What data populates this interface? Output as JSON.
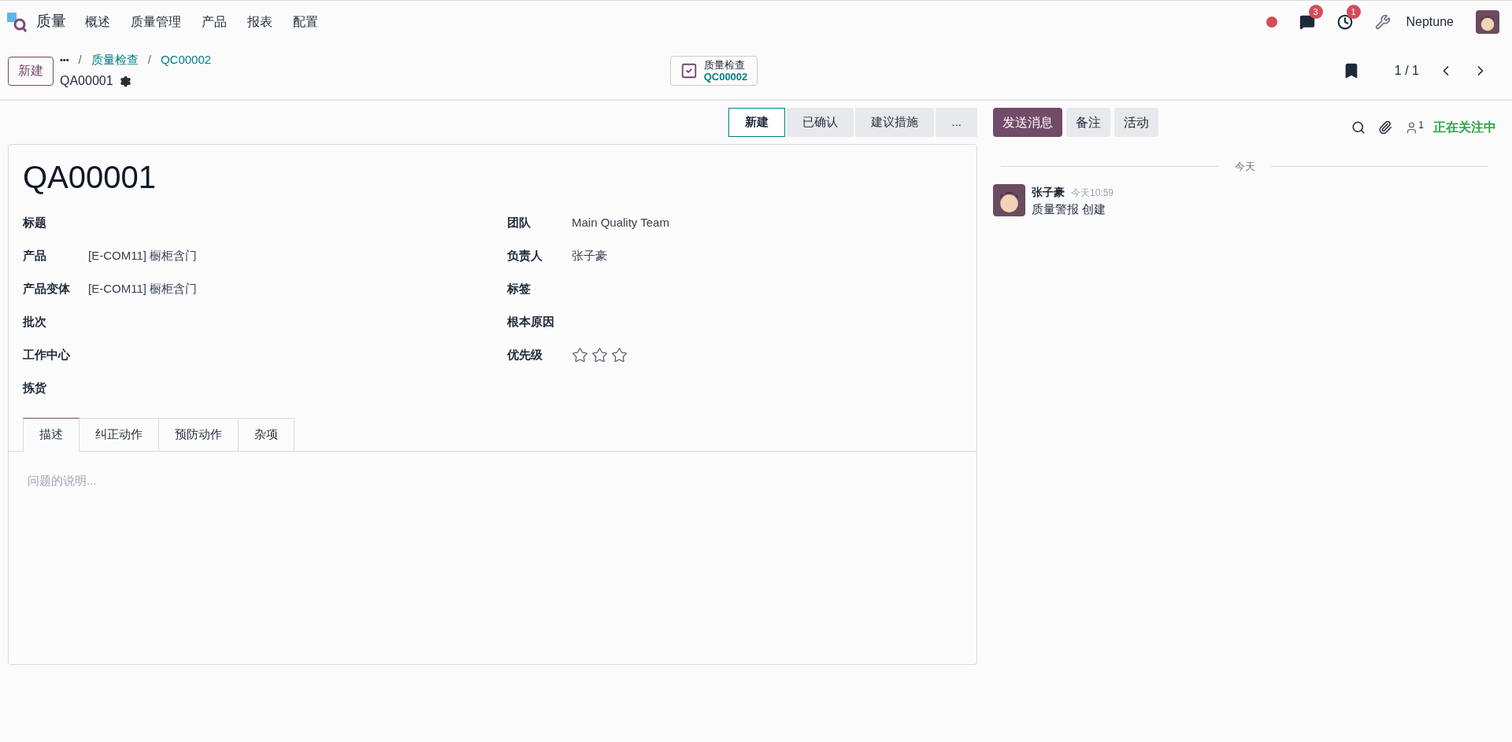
{
  "navbar": {
    "app_name": "质量",
    "menu": [
      "概述",
      "质量管理",
      "产品",
      "报表",
      "配置"
    ],
    "messages_badge": "3",
    "activities_badge": "1",
    "user": "Neptune"
  },
  "control_panel": {
    "new_button": "新建",
    "breadcrumb_more": "•••",
    "breadcrumbs": [
      {
        "separator": "/",
        "label": "质量检查"
      },
      {
        "separator": "/",
        "label": "QC00002"
      }
    ],
    "record": "QA00001",
    "smart_button": {
      "label": "质量检查",
      "value": "QC00002"
    },
    "pager": "1 / 1"
  },
  "statusbar": [
    {
      "label": "新建",
      "selected": true
    },
    {
      "label": "已确认",
      "selected": false
    },
    {
      "label": "建议措施",
      "selected": false
    },
    {
      "label": "...",
      "selected": false
    }
  ],
  "form": {
    "title": "QA00001",
    "left_fields": [
      {
        "label": "标题"
      },
      {
        "label": "产品",
        "value": "[E-COM11] 橱柜含门"
      },
      {
        "label": "产品变体",
        "value": "[E-COM11] 橱柜含门"
      },
      {
        "label": "批次"
      },
      {
        "label": "工作中心"
      },
      {
        "label": "拣货"
      }
    ],
    "right_fields": [
      {
        "label": "团队",
        "value": "Main Quality Team"
      },
      {
        "label": "负责人",
        "value": "张子豪"
      },
      {
        "label": "标签"
      },
      {
        "label": "根本原因"
      }
    ],
    "priority": {
      "label": "优先级",
      "stars": 0
    },
    "tabs": [
      {
        "label": "描述",
        "selected": true
      },
      {
        "label": "纠正动作",
        "selected": false
      },
      {
        "label": "预防动作",
        "selected": false
      },
      {
        "label": "杂项",
        "selected": false
      }
    ],
    "description_placeholder": "问题的说明..."
  },
  "chatter": {
    "buttons": [
      "发送消息",
      "备注",
      "活动"
    ],
    "followers_count": "1",
    "following": "正在关注中",
    "date_separator": "今天",
    "messages": [
      {
        "author": "张子豪",
        "time": "今天10:59",
        "body": "质量警报 创建"
      }
    ]
  }
}
